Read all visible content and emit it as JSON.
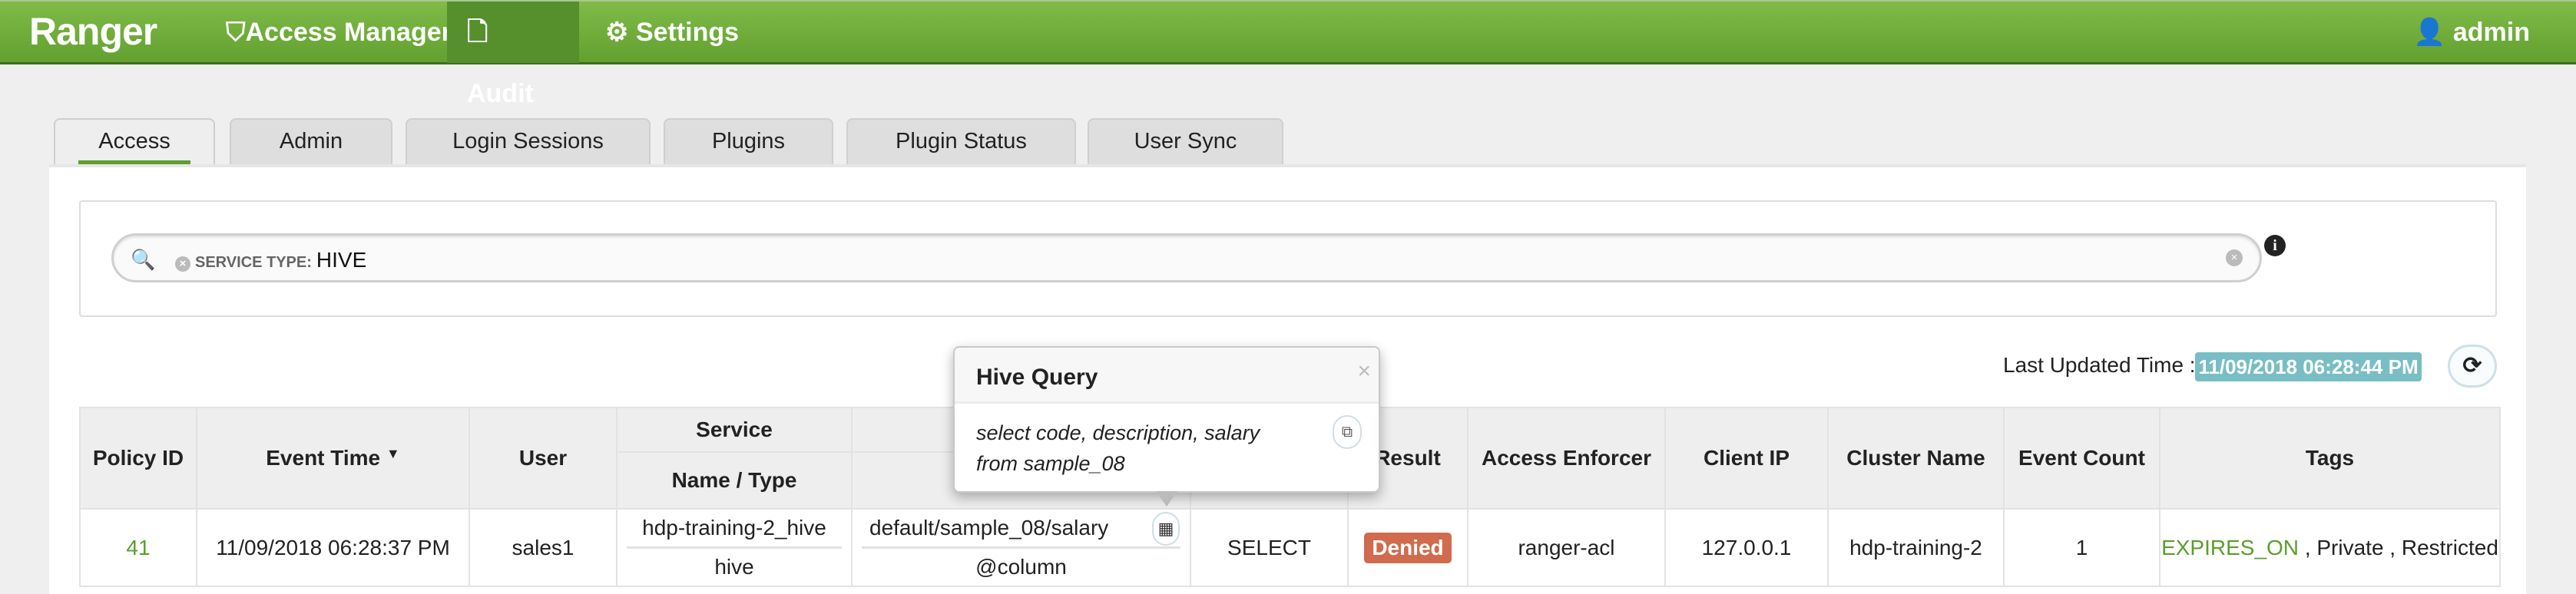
{
  "nav": {
    "brand": "Ranger",
    "items": [
      {
        "label": "Access Manager",
        "icon": "shield-icon"
      },
      {
        "label": "Audit",
        "icon": "file-icon",
        "active": true
      },
      {
        "label": "Settings",
        "icon": "gear-icon"
      }
    ],
    "user": "admin"
  },
  "tabs": [
    {
      "label": "Access",
      "active": true
    },
    {
      "label": "Admin"
    },
    {
      "label": "Login Sessions"
    },
    {
      "label": "Plugins"
    },
    {
      "label": "Plugin Status"
    },
    {
      "label": "User Sync"
    }
  ],
  "search": {
    "facet_label": "SERVICE TYPE:",
    "facet_value": "HIVE"
  },
  "last_updated": {
    "label": "Last Updated Time :",
    "value": "11/09/2018 06:28:44 PM"
  },
  "table": {
    "headers": {
      "policy_id": "Policy ID",
      "event_time": "Event Time",
      "user": "User",
      "service": "Service",
      "service_sub": "Name / Type",
      "result": "Result",
      "access_enforcer": "Access Enforcer",
      "client_ip": "Client IP",
      "cluster_name": "Cluster Name",
      "event_count": "Event Count",
      "tags": "Tags"
    },
    "rows": [
      {
        "policy_id": "41",
        "event_time": "11/09/2018 06:28:37 PM",
        "user": "sales1",
        "service_name": "hdp-training-2_hive",
        "service_type": "hive",
        "resource_name": "default/sample_08/salary",
        "resource_type": "@column",
        "access_type": "SELECT",
        "result": "Denied",
        "access_enforcer": "ranger-acl",
        "client_ip": "127.0.0.1",
        "cluster_name": "hdp-training-2",
        "event_count": "1",
        "tags": [
          {
            "label": "EXPIRES_ON",
            "color": "#5a9e2a"
          },
          {
            "label": ", Private"
          },
          {
            "label": ", Restricted"
          }
        ]
      }
    ]
  },
  "popover": {
    "title": "Hive Query",
    "query": "select code, description, salary from sample_08"
  },
  "colors": {
    "nav": "#6aa838",
    "badge": "#78bec4",
    "denied": "#d06b4d",
    "link": "#5a9e2a"
  }
}
